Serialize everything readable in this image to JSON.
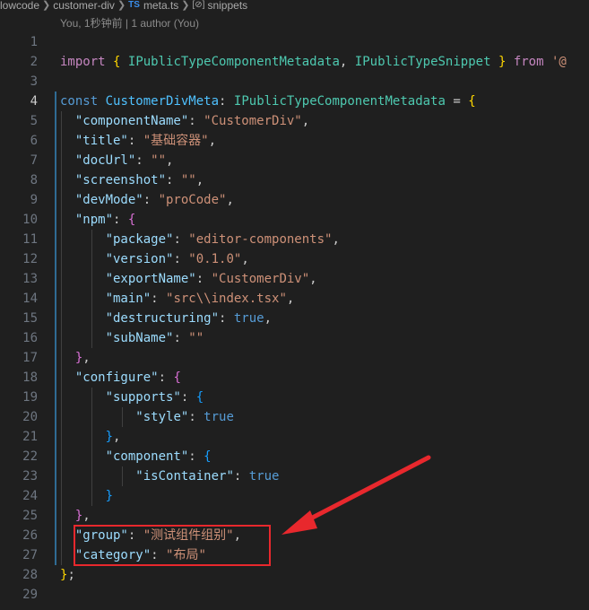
{
  "breadcrumb": {
    "root": "lowcode",
    "folder": "customer-div",
    "ts_badge": "TS",
    "file": "meta.ts",
    "symbol_icon": "[⊘]",
    "symbol": "snippets"
  },
  "blame": "You, 1秒钟前 | 1 author (You)",
  "code": {
    "l1": "1",
    "l2": "2",
    "import": "import",
    "lb": "{",
    "t1": "IPublicTypeComponentMetadata",
    "comma": ",",
    "t2": "IPublicTypeSnippet",
    "rb": "}",
    "from": "from",
    "src_trunc": "'@",
    "l3": "3",
    "l4": "4",
    "const": "const",
    "varname": "CustomerDivMeta",
    "colon": ":",
    "type": "IPublicTypeComponentMetadata",
    "eq": "=",
    "open": "{",
    "l5": "5",
    "k5": "\"componentName\"",
    "v5": "\"CustomerDiv\"",
    "l6": "6",
    "k6": "\"title\"",
    "v6": "\"基础容器\"",
    "l7": "7",
    "k7": "\"docUrl\"",
    "v7": "\"\"",
    "l8": "8",
    "k8": "\"screenshot\"",
    "v8": "\"\"",
    "l9": "9",
    "k9": "\"devMode\"",
    "v9": "\"proCode\"",
    "l10": "10",
    "k10": "\"npm\"",
    "l11": "11",
    "k11": "\"package\"",
    "v11": "\"editor-components\"",
    "l12": "12",
    "k12": "\"version\"",
    "v12": "\"0.1.0\"",
    "l13": "13",
    "k13": "\"exportName\"",
    "v13": "\"CustomerDiv\"",
    "l14": "14",
    "k14": "\"main\"",
    "v14": "\"src\\\\index.tsx\"",
    "l15": "15",
    "k15": "\"destructuring\"",
    "v15": "true",
    "l16": "16",
    "k16": "\"subName\"",
    "v16": "\"\"",
    "l17": "17",
    "close_comma": "},",
    "l18": "18",
    "k18": "\"configure\"",
    "l19": "19",
    "k19": "\"supports\"",
    "l20": "20",
    "k20": "\"style\"",
    "v20": "true",
    "l21": "21",
    "l22": "22",
    "k22": "\"component\"",
    "l23": "23",
    "k23": "\"isContainer\"",
    "v23": "true",
    "l24": "24",
    "close": "}",
    "l25": "25",
    "l26": "26",
    "k26": "\"group\"",
    "v26": "\"测试组件组别\"",
    "l27": "27",
    "k27": "\"category\"",
    "v27": "\"布局\"",
    "l28": "28",
    "end": "};",
    "l29": "29"
  },
  "annotation": {
    "box_color": "#e8282d",
    "arrow_color": "#e8282d"
  }
}
